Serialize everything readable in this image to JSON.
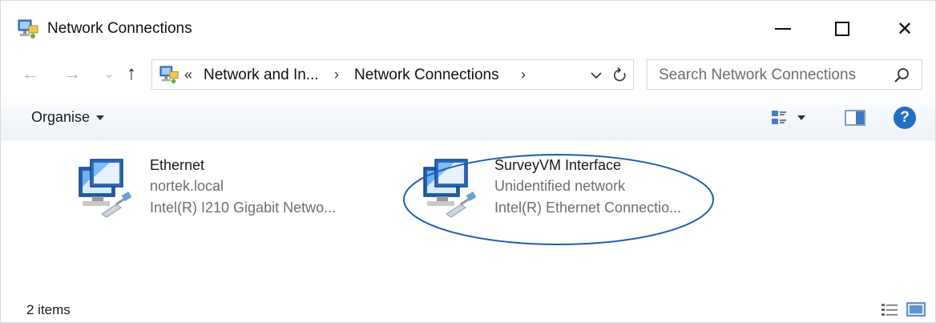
{
  "window": {
    "title": "Network Connections",
    "title_icon": "network-connections-icon"
  },
  "controls": {
    "minimize_icon": "minimize-icon",
    "maximize_icon": "maximize-icon",
    "close_icon": "close-icon",
    "close_glyph": "✕"
  },
  "nav": {
    "back_glyph": "←",
    "forward_glyph": "→",
    "recent_glyph": "⌄",
    "up_glyph": "↑"
  },
  "address": {
    "overflow_glyph": "«",
    "crumbs": [
      {
        "label": "Network and In..."
      },
      {
        "label": "Network Connections"
      }
    ],
    "separator_glyph": "›"
  },
  "search": {
    "placeholder": "Search Network Connections"
  },
  "toolbar": {
    "organise_label": "Organise",
    "help_glyph": "?"
  },
  "items": [
    {
      "name": "Ethernet",
      "network": "nortek.local",
      "adapter": "Intel(R) I210 Gigabit Netwo..."
    },
    {
      "name": "SurveyVM Interface",
      "network": "Unidentified network",
      "adapter": "Intel(R) Ethernet Connectio..."
    }
  ],
  "status": {
    "item_count": "2 items"
  },
  "colors": {
    "accent": "#1f6fc8",
    "highlight_ellipse": "#1d5fb0"
  }
}
